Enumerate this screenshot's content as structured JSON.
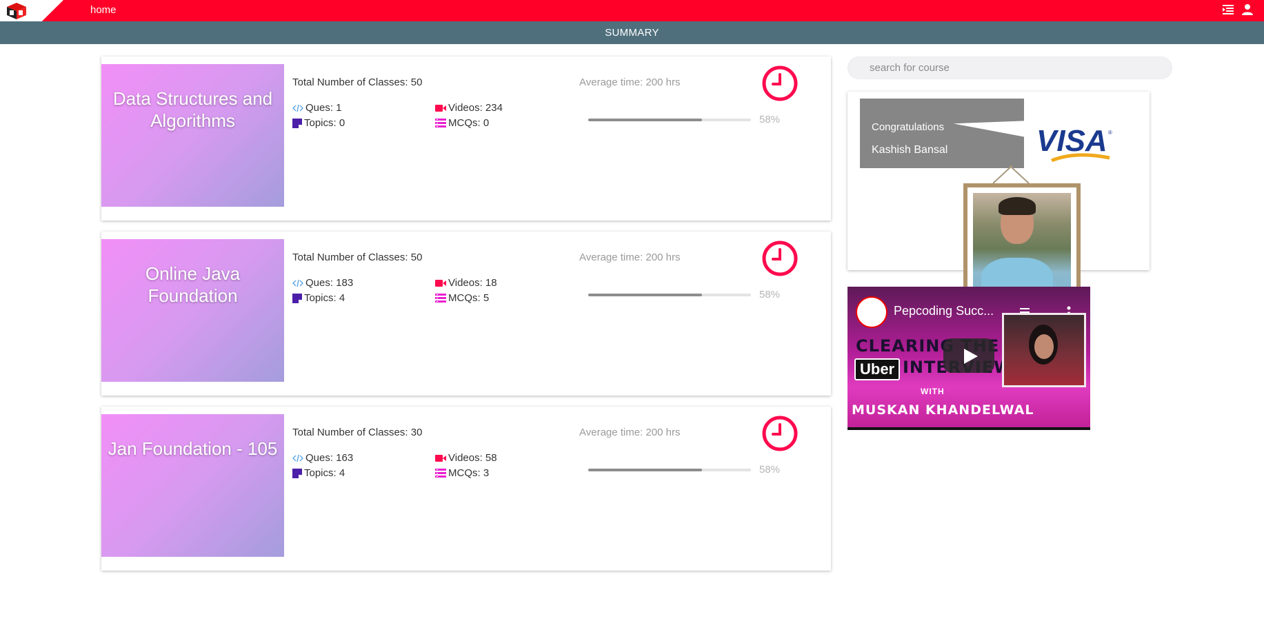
{
  "nav": {
    "home_label": "home",
    "colors": {
      "topbar": "#ff0028",
      "summary_bar": "#4f6f7d"
    }
  },
  "summary": {
    "title": "SUMMARY"
  },
  "courses": [
    {
      "title": "Data Structures and Algorithms",
      "classes": "Total Number of Classes: 50",
      "ques": "Ques: 1",
      "videos": "Videos: 234",
      "topics": "Topics: 0",
      "mcqs": "MCQs: 0",
      "avg_time": "Average time: 200 hrs",
      "progress_text": "58%",
      "progress_fill": 0.7
    },
    {
      "title": "Online Java Foundation",
      "classes": "Total Number of Classes: 50",
      "ques": "Ques: 183",
      "videos": "Videos: 18",
      "topics": "Topics: 4",
      "mcqs": "MCQs: 5",
      "avg_time": "Average time: 200 hrs",
      "progress_text": "58%",
      "progress_fill": 0.7
    },
    {
      "title": "Jan Foundation - 105",
      "classes": "Total Number of Classes: 30",
      "ques": "Ques: 163",
      "videos": "Videos: 58",
      "topics": "Topics: 4",
      "mcqs": "MCQs: 3",
      "avg_time": "Average time: 200 hrs",
      "progress_text": "58%",
      "progress_fill": 0.7
    }
  ],
  "search": {
    "placeholder": "search for course"
  },
  "congrats": {
    "heading": "Congratulations",
    "name": "Kashish Bansal",
    "company_logo_text": "VISA"
  },
  "video": {
    "channel_title": "Pepcoding Succ...",
    "line1": "CLEARING THE",
    "brand": "Uber",
    "line2": "INTERVIEW",
    "with_text": "WITH",
    "line3": "MUSKAN KHANDELWAL"
  },
  "icons": {
    "ques": "code-icon",
    "videos": "video-camera-icon",
    "topics": "note-icon",
    "mcqs": "list-icon",
    "clock": "clock-icon",
    "menu": "menu-icon",
    "user": "user-icon"
  }
}
